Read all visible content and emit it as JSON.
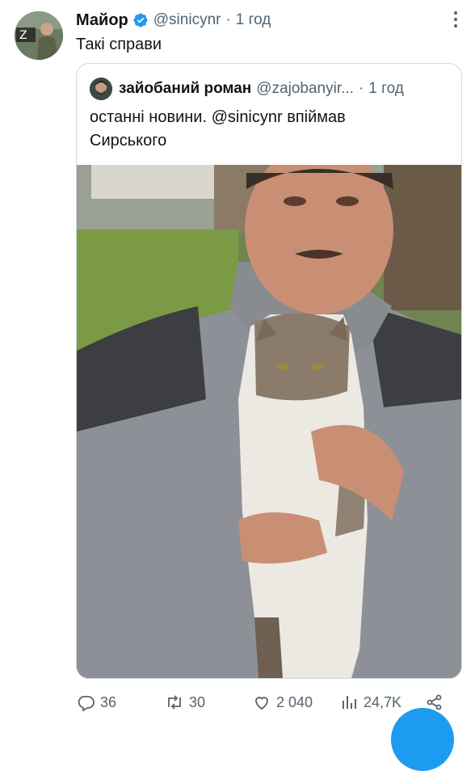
{
  "tweet": {
    "author_name": "Майор",
    "handle": "@sinicynr",
    "separator": "·",
    "time": "1 год",
    "text": "Такі справи"
  },
  "quoted_tweet": {
    "author_name": "зайобаний роман",
    "handle": "@zajobanyir...",
    "separator": "·",
    "time": "1 год",
    "text_line1": "останні новини. @sinicynr впіймав",
    "text_line2": "Сирського"
  },
  "actions": {
    "replies": "36",
    "retweets": "30",
    "likes": "2 040",
    "views": "24,7K"
  },
  "colors": {
    "text": "#0f1419",
    "secondary": "#536471",
    "border": "#cfd9de",
    "verified": "#1d9bf0",
    "fab": "#1d9bf0"
  },
  "icons": {
    "verified": "verified-badge-icon",
    "more": "more-dots-icon",
    "reply": "reply-icon",
    "retweet": "retweet-icon",
    "like": "heart-icon",
    "views": "views-icon",
    "share": "share-icon"
  }
}
